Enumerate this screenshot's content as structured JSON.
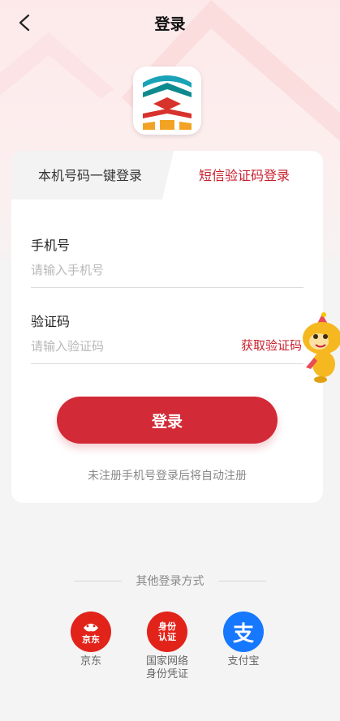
{
  "header": {
    "title": "登录"
  },
  "tabs": [
    {
      "label": "本机号码一键登录"
    },
    {
      "label": "短信验证码登录"
    }
  ],
  "form": {
    "phone_label": "手机号",
    "phone_placeholder": "请输入手机号",
    "code_label": "验证码",
    "code_placeholder": "请输入验证码",
    "get_code": "获取验证码",
    "submit": "登录",
    "hint": "未注册手机号登录后将自动注册"
  },
  "other_login": {
    "title": "其他登录方式",
    "methods": [
      {
        "icon_text": "京东",
        "label": "京东",
        "color": "#e2231a"
      },
      {
        "icon_text": "身份\n认证",
        "label": "国家网络\n身份凭证",
        "color": "#e2231a"
      },
      {
        "icon_text": "支",
        "label": "支付宝",
        "color": "#1677ff"
      }
    ]
  },
  "colors": {
    "accent": "#c8202d",
    "button": "#d22a36"
  }
}
